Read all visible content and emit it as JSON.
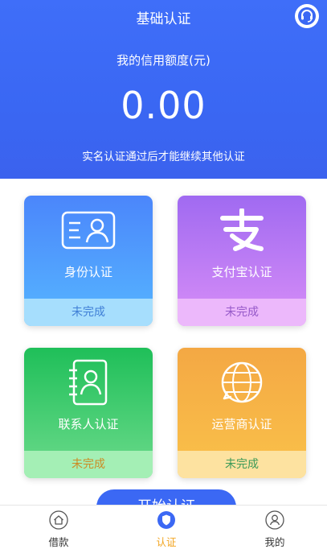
{
  "header": {
    "title": "基础认证",
    "credit_label": "我的信用额度(元)",
    "credit_value": "0.00",
    "hint": "实名认证通过后才能继续其他认证"
  },
  "cards": [
    {
      "icon": "id-card-icon",
      "label": "身份认证",
      "status": "未完成"
    },
    {
      "icon": "alipay-icon",
      "label": "支付宝认证",
      "status": "未完成"
    },
    {
      "icon": "contacts-book-icon",
      "label": "联系人认证",
      "status": "未完成"
    },
    {
      "icon": "globe-icon",
      "label": "运营商认证",
      "status": "未完成"
    }
  ],
  "start_button": "开始认证",
  "tabs": [
    {
      "icon": "home-icon",
      "label": "借款"
    },
    {
      "icon": "shield-icon",
      "label": "认证",
      "active": true
    },
    {
      "icon": "user-icon",
      "label": "我的"
    }
  ],
  "colors": {
    "primary": "#3b68f4",
    "active_tab": "#f2a31c"
  }
}
